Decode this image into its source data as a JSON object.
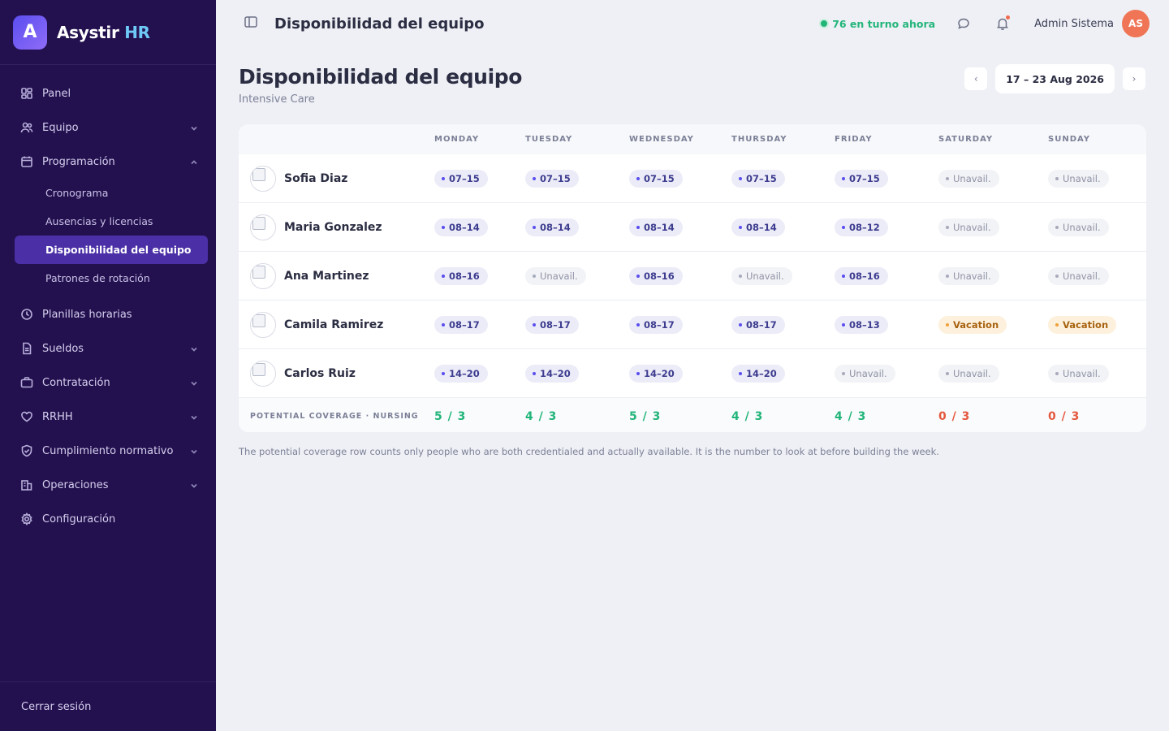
{
  "brand": {
    "letter": "A",
    "name": "Asystir",
    "suffix": "HR"
  },
  "sidebar": {
    "items": [
      {
        "label": "Panel",
        "icon": "grid-icon",
        "chevron": ""
      },
      {
        "label": "Equipo",
        "icon": "users-icon",
        "chevron": "down"
      },
      {
        "label": "Programación",
        "icon": "calendar-icon",
        "chevron": "up"
      },
      {
        "label": "Planillas horarias",
        "icon": "clock-icon",
        "chevron": ""
      },
      {
        "label": "Sueldos",
        "icon": "document-icon",
        "chevron": "down"
      },
      {
        "label": "Contratación",
        "icon": "briefcase-icon",
        "chevron": "down"
      },
      {
        "label": "RRHH",
        "icon": "heart-icon",
        "chevron": "down"
      },
      {
        "label": "Cumplimiento normativo",
        "icon": "shield-icon",
        "chevron": "down"
      },
      {
        "label": "Operaciones",
        "icon": "building-icon",
        "chevron": "down"
      },
      {
        "label": "Configuración",
        "icon": "gear-icon",
        "chevron": ""
      }
    ],
    "subitems": [
      {
        "label": "Cronograma",
        "active": false
      },
      {
        "label": "Ausencias y licencias",
        "active": false
      },
      {
        "label": "Disponibilidad del equipo",
        "active": true
      },
      {
        "label": "Patrones de rotación",
        "active": false
      }
    ],
    "logout": "Cerrar sesión"
  },
  "topbar": {
    "title": "Disponibilidad del equipo",
    "shift_status": "76 en turno ahora",
    "user_name": "Admin Sistema",
    "user_initials": "AS"
  },
  "page": {
    "title": "Disponibilidad del equipo",
    "subtitle": "Intensive Care",
    "week_range": "17 – 23 Aug 2026",
    "prev": "‹",
    "next": "›"
  },
  "table": {
    "days": [
      "MONDAY",
      "TUESDAY",
      "WEDNESDAY",
      "THURSDAY",
      "FRIDAY",
      "SATURDAY",
      "SUNDAY"
    ],
    "rows": [
      {
        "name": "Sofia Diaz",
        "cells": [
          {
            "type": "shift",
            "text": "07–15"
          },
          {
            "type": "shift",
            "text": "07–15"
          },
          {
            "type": "shift",
            "text": "07–15"
          },
          {
            "type": "shift",
            "text": "07–15"
          },
          {
            "type": "shift",
            "text": "07–15"
          },
          {
            "type": "unavail",
            "text": "Unavail."
          },
          {
            "type": "unavail",
            "text": "Unavail."
          }
        ]
      },
      {
        "name": "Maria Gonzalez",
        "cells": [
          {
            "type": "shift",
            "text": "08–14"
          },
          {
            "type": "shift",
            "text": "08–14"
          },
          {
            "type": "shift",
            "text": "08–14"
          },
          {
            "type": "shift",
            "text": "08–14"
          },
          {
            "type": "shift",
            "text": "08–12"
          },
          {
            "type": "unavail",
            "text": "Unavail."
          },
          {
            "type": "unavail",
            "text": "Unavail."
          }
        ]
      },
      {
        "name": "Ana Martinez",
        "cells": [
          {
            "type": "shift",
            "text": "08–16"
          },
          {
            "type": "unavail",
            "text": "Unavail."
          },
          {
            "type": "shift",
            "text": "08–16"
          },
          {
            "type": "unavail",
            "text": "Unavail."
          },
          {
            "type": "shift",
            "text": "08–16"
          },
          {
            "type": "unavail",
            "text": "Unavail."
          },
          {
            "type": "unavail",
            "text": "Unavail."
          }
        ]
      },
      {
        "name": "Camila Ramirez",
        "cells": [
          {
            "type": "shift",
            "text": "08–17"
          },
          {
            "type": "shift",
            "text": "08–17"
          },
          {
            "type": "shift",
            "text": "08–17"
          },
          {
            "type": "shift",
            "text": "08–17"
          },
          {
            "type": "shift",
            "text": "08–13"
          },
          {
            "type": "vacation",
            "text": "Vacation"
          },
          {
            "type": "vacation",
            "text": "Vacation"
          }
        ]
      },
      {
        "name": "Carlos Ruiz",
        "cells": [
          {
            "type": "shift",
            "text": "14–20"
          },
          {
            "type": "shift",
            "text": "14–20"
          },
          {
            "type": "shift",
            "text": "14–20"
          },
          {
            "type": "shift",
            "text": "14–20"
          },
          {
            "type": "unavail",
            "text": "Unavail."
          },
          {
            "type": "unavail",
            "text": "Unavail."
          },
          {
            "type": "unavail",
            "text": "Unavail."
          }
        ]
      }
    ],
    "coverage": {
      "label": "POTENTIAL COVERAGE · NURSING",
      "values": [
        {
          "text": "5 / 3",
          "status": "ok"
        },
        {
          "text": "4 / 3",
          "status": "ok"
        },
        {
          "text": "5 / 3",
          "status": "ok"
        },
        {
          "text": "4 / 3",
          "status": "ok"
        },
        {
          "text": "4 / 3",
          "status": "ok"
        },
        {
          "text": "0 / 3",
          "status": "bad"
        },
        {
          "text": "0 / 3",
          "status": "bad"
        }
      ]
    }
  },
  "footnote": "The potential coverage row counts only people who are both credentialed and actually available. It is the number to look at before building the week.",
  "colors": {
    "sidebar_bg": "#23104f",
    "accent": "#4a2fa6",
    "ok": "#22b57a",
    "bad": "#e4583e",
    "vacation": "#a7620f"
  }
}
